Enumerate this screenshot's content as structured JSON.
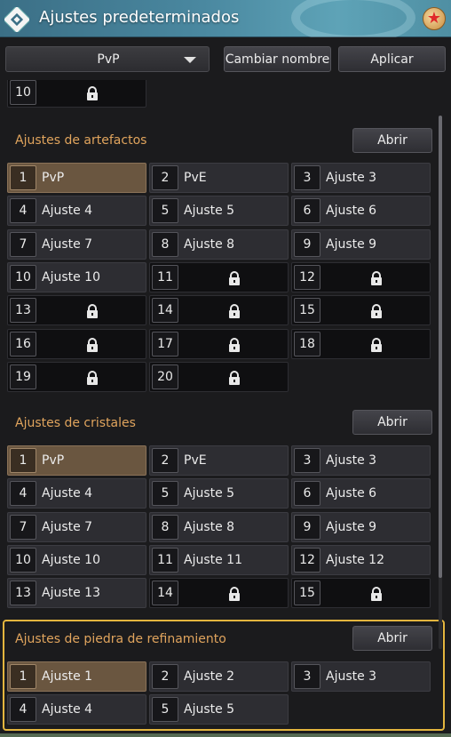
{
  "window": {
    "title": "Ajustes predeterminados",
    "favorite_icon": "star-icon"
  },
  "toolbar": {
    "preset_value": "PvP",
    "rename_label": "Cambiar nombre",
    "apply_label": "Aplicar"
  },
  "top_partial_row": [
    {
      "num": "10",
      "label": "",
      "locked": true
    }
  ],
  "artifacts": {
    "title": "Ajustes de artefactos",
    "open_label": "Abrir",
    "slots": [
      {
        "num": "1",
        "label": "PvP",
        "locked": false,
        "active": true
      },
      {
        "num": "2",
        "label": "PvE",
        "locked": false
      },
      {
        "num": "3",
        "label": "Ajuste 3",
        "locked": false
      },
      {
        "num": "4",
        "label": "Ajuste 4",
        "locked": false
      },
      {
        "num": "5",
        "label": "Ajuste 5",
        "locked": false
      },
      {
        "num": "6",
        "label": "Ajuste 6",
        "locked": false
      },
      {
        "num": "7",
        "label": "Ajuste 7",
        "locked": false
      },
      {
        "num": "8",
        "label": "Ajuste 8",
        "locked": false
      },
      {
        "num": "9",
        "label": "Ajuste 9",
        "locked": false
      },
      {
        "num": "10",
        "label": "Ajuste 10",
        "locked": false
      },
      {
        "num": "11",
        "label": "",
        "locked": true
      },
      {
        "num": "12",
        "label": "",
        "locked": true
      },
      {
        "num": "13",
        "label": "",
        "locked": true
      },
      {
        "num": "14",
        "label": "",
        "locked": true
      },
      {
        "num": "15",
        "label": "",
        "locked": true
      },
      {
        "num": "16",
        "label": "",
        "locked": true
      },
      {
        "num": "17",
        "label": "",
        "locked": true
      },
      {
        "num": "18",
        "label": "",
        "locked": true
      },
      {
        "num": "19",
        "label": "",
        "locked": true
      },
      {
        "num": "20",
        "label": "",
        "locked": true
      }
    ]
  },
  "crystals": {
    "title": "Ajustes de cristales",
    "open_label": "Abrir",
    "slots": [
      {
        "num": "1",
        "label": "PvP",
        "locked": false,
        "active": true
      },
      {
        "num": "2",
        "label": "PvE",
        "locked": false
      },
      {
        "num": "3",
        "label": "Ajuste 3",
        "locked": false
      },
      {
        "num": "4",
        "label": "Ajuste 4",
        "locked": false
      },
      {
        "num": "5",
        "label": "Ajuste 5",
        "locked": false
      },
      {
        "num": "6",
        "label": "Ajuste 6",
        "locked": false
      },
      {
        "num": "7",
        "label": "Ajuste 7",
        "locked": false
      },
      {
        "num": "8",
        "label": "Ajuste 8",
        "locked": false
      },
      {
        "num": "9",
        "label": "Ajuste 9",
        "locked": false
      },
      {
        "num": "10",
        "label": "Ajuste 10",
        "locked": false
      },
      {
        "num": "11",
        "label": "Ajuste 11",
        "locked": false
      },
      {
        "num": "12",
        "label": "Ajuste 12",
        "locked": false
      },
      {
        "num": "13",
        "label": "Ajuste 13",
        "locked": false
      },
      {
        "num": "14",
        "label": "",
        "locked": true
      },
      {
        "num": "15",
        "label": "",
        "locked": true
      }
    ]
  },
  "refinement": {
    "title": "Ajustes de piedra de refinamiento",
    "open_label": "Abrir",
    "slots": [
      {
        "num": "1",
        "label": "Ajuste 1",
        "locked": false,
        "active": true
      },
      {
        "num": "2",
        "label": "Ajuste 2",
        "locked": false
      },
      {
        "num": "3",
        "label": "Ajuste 3",
        "locked": false
      },
      {
        "num": "4",
        "label": "Ajuste 4",
        "locked": false
      },
      {
        "num": "5",
        "label": "Ajuste 5",
        "locked": false
      }
    ]
  },
  "colors": {
    "accent_title": "#e0a45d",
    "highlight_border": "#e3b53e",
    "active_slot": "#6a5640"
  }
}
